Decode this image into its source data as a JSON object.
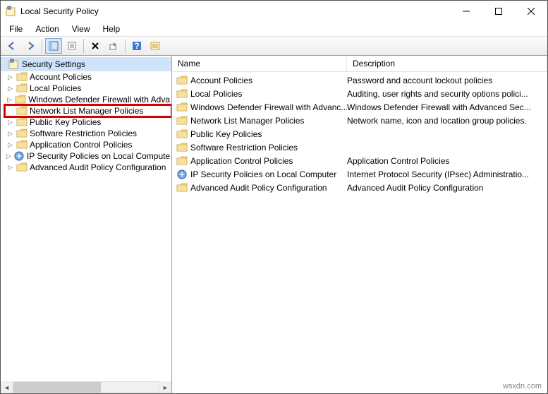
{
  "window": {
    "title": "Local Security Policy"
  },
  "menu": {
    "file": "File",
    "action": "Action",
    "view": "View",
    "help": "Help"
  },
  "tree": {
    "root": "Security Settings",
    "items": [
      {
        "label": "Account Policies"
      },
      {
        "label": "Local Policies"
      },
      {
        "label": "Windows Defender Firewall with Adva"
      },
      {
        "label": "Network List Manager Policies",
        "no_expander": true,
        "highlighted": true
      },
      {
        "label": "Public Key Policies"
      },
      {
        "label": "Software Restriction Policies"
      },
      {
        "label": "Application Control Policies"
      },
      {
        "label": "IP Security Policies on Local Compute",
        "special_icon": true
      },
      {
        "label": "Advanced Audit Policy Configuration"
      }
    ]
  },
  "list": {
    "headers": {
      "name": "Name",
      "description": "Description"
    },
    "rows": [
      {
        "name": "Account Policies",
        "desc": "Password and account lockout policies"
      },
      {
        "name": "Local Policies",
        "desc": "Auditing, user rights and security options polici..."
      },
      {
        "name": "Windows Defender Firewall with Advanc...",
        "desc": "Windows Defender Firewall with Advanced Sec..."
      },
      {
        "name": "Network List Manager Policies",
        "desc": "Network name, icon and location group policies."
      },
      {
        "name": "Public Key Policies",
        "desc": ""
      },
      {
        "name": "Software Restriction Policies",
        "desc": ""
      },
      {
        "name": "Application Control Policies",
        "desc": "Application Control Policies"
      },
      {
        "name": "IP Security Policies on Local Computer",
        "desc": "Internet Protocol Security (IPsec) Administratio...",
        "special_icon": true
      },
      {
        "name": "Advanced Audit Policy Configuration",
        "desc": "Advanced Audit Policy Configuration"
      }
    ]
  },
  "watermark": "wsxdn.com"
}
